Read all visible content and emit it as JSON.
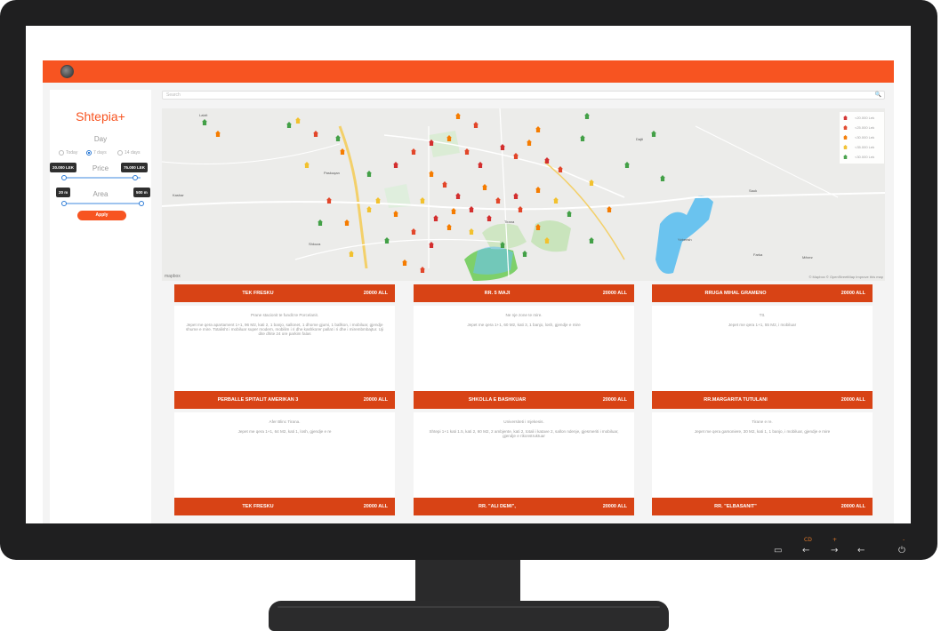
{
  "app": {
    "brand": "Shtepia+",
    "search_placeholder": "Search",
    "day_label": "Day",
    "day_options": [
      "Today",
      "7 days",
      "14 days"
    ],
    "day_selected": "7 days",
    "price_label": "Price",
    "price_min": "20.000 LEK",
    "price_max": "75.000 LEK",
    "area_label": "Area",
    "area_min": "20 m",
    "area_max": "500 m",
    "apply_label": "Apply"
  },
  "map": {
    "legend": [
      "<20.000 Lek",
      "<25.000 Lek",
      "<30.000 Lek",
      "<35.000 Lek",
      "<30.000 Lek"
    ],
    "legend_colors": [
      "#d32f2f",
      "#e2462a",
      "#f57c00",
      "#f2c12e",
      "#43a047"
    ],
    "attribution": "© Mapbox © OpenStreetMap Improve this map",
    "logo": "mapbox",
    "places": [
      "Lalzit",
      "Shkoza",
      "Paskuqan",
      "Yzberish",
      "Tirana",
      "Sauk",
      "Farka",
      "Kashar",
      "Dajti",
      "Mëzez"
    ]
  },
  "listings": [
    {
      "street": "TEK FRESKU",
      "price": "20000 ALL",
      "title": "Prane stacionit te fundit te Porcelanit.",
      "desc": "Jepet me qera apartament 1+1, 96 M2, kati 2, 1 banjo, sallonet, 1 dhome gjumi, 1 ballkon, i mobiluar, gjendje shume e mire. Totalisht i mobiluar super modern, mobilim i ri dhe kashkorer pallat i ri dhe i mirembmbajtur. Uji dite dhite 24 ore parkim falas"
    },
    {
      "street": "RR. 5 MAJI",
      "price": "20000 ALL",
      "title": "Ne nje zone te mire.",
      "desc": "Jepet me qera 1+1, 60 M2, kati 3, 1 banjo, losh, gjendje e mire"
    },
    {
      "street": "RRUGA MIHAL GRAMENO",
      "price": "20000 ALL",
      "title": "Ttt.",
      "desc": "Jepet me qera 1+1, 55 M2, i mobiluar"
    },
    {
      "street": "PERBALLE SPITALIT AMERIKAN 3",
      "price": "20000 ALL",
      "title": "Afer Blinc Tirana.",
      "desc": "Jepet me qera 1+1, 64 M2, kati 1, losh, gjendje e re"
    },
    {
      "street": "SHKOLLA E BASHKUAR",
      "price": "20000 ALL",
      "title": "Universiteti i mjekesis.",
      "desc": "Shtepi 1+1 kati 1.5, kati 2, 60 M2, 2 ambjente, kati 2, totali i katave 2, sallon ndenje, gjesmeriti i mobiluar, gjendje e rikonstruktuar"
    },
    {
      "street": "RR.MARGARITA TUTULANI",
      "price": "20000 ALL",
      "title": "Tirane e re.",
      "desc": "Jepet me qera garsoniere, 30 M2, kati 1, 1 banjo, i mobiluar, gjendje e mire"
    },
    {
      "street": "TEK FRESKU",
      "price": "20000 ALL",
      "title": "",
      "desc": ""
    },
    {
      "street": "RR. \"ALI DEMI\",",
      "price": "20000 ALL",
      "title": "",
      "desc": ""
    },
    {
      "street": "RR. \"ELBASANIT\"",
      "price": "20000 ALL",
      "title": "",
      "desc": ""
    }
  ],
  "bezel": {
    "top": [
      "CD",
      "+",
      "-"
    ],
    "icons": [
      "input-icon",
      "left-arrow-icon",
      "right-arrow-icon",
      "back-icon",
      "power-icon"
    ]
  }
}
